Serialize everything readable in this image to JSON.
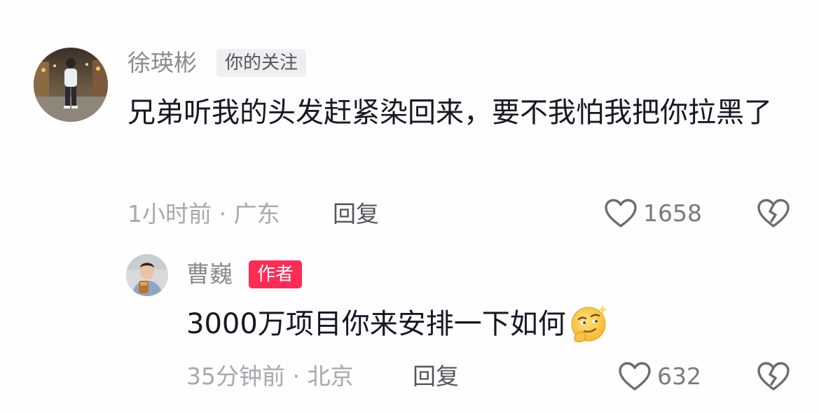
{
  "comments": [
    {
      "username": "徐瑛彬",
      "tag": "你的关注",
      "text": "兄弟听我的头发赶紧染回来，要不我怕我把你拉黑了",
      "meta": "1小时前 · 广东",
      "reply_label": "回复",
      "likes": "1658",
      "avatar_icon": "user-photo-street",
      "like_icon": "heart-outline-icon",
      "dislike_icon": "broken-heart-icon"
    },
    {
      "username": "曹巍",
      "tag": "作者",
      "text": "3000万项目你来安排一下如何",
      "text_emoji": "thinking-smirk-emoji",
      "meta": "35分钟前 · 北京",
      "reply_label": "回复",
      "likes": "632",
      "avatar_icon": "user-photo-portrait",
      "like_icon": "heart-outline-icon",
      "dislike_icon": "broken-heart-icon"
    }
  ],
  "colors": {
    "author_tag": "#fe2c55",
    "follow_tag_bg": "#efeff1",
    "username": "#8a8b91",
    "meta": "#a7a8ad",
    "text": "#161823"
  }
}
